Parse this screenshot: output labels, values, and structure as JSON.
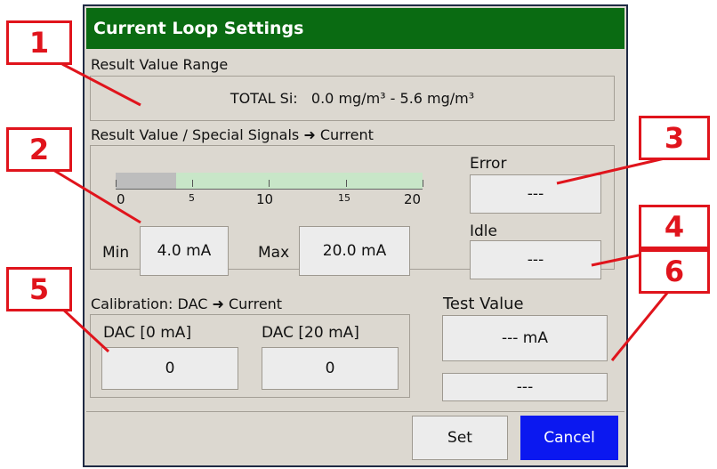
{
  "dialog": {
    "title": "Current Loop Settings"
  },
  "result_range": {
    "label": "Result Value Range",
    "value": "TOTAL Si:   0.0 mg/m³ - 5.6 mg/m³"
  },
  "signals": {
    "label": "Result Value / Special Signals ➜ Current",
    "gauge": {
      "scale_min": 0,
      "scale_max": 20,
      "filled_start_mA": 4,
      "tick_labels": [
        "0",
        "5",
        "10",
        "15",
        "20"
      ],
      "colors": {
        "below_min": "#bdbdbd",
        "range": "#c8e6c8"
      }
    },
    "min_label": "Min",
    "min_value": "4.0 mA",
    "max_label": "Max",
    "max_value": "20.0 mA",
    "error_label": "Error",
    "error_value": "---",
    "idle_label": "Idle",
    "idle_value": "---"
  },
  "calibration": {
    "label": "Calibration: DAC ➜ Current",
    "dac0_label": "DAC [0 mA]",
    "dac0_value": "0",
    "dac20_label": "DAC [20 mA]",
    "dac20_value": "0"
  },
  "test": {
    "label": "Test Value",
    "value": "--- mA",
    "status": "---"
  },
  "buttons": {
    "set": "Set",
    "cancel": "Cancel"
  },
  "callouts": [
    "1",
    "2",
    "3",
    "4",
    "5",
    "6"
  ],
  "colors": {
    "title_bar": "#0a6b12",
    "cancel_button": "#0b18f0",
    "callout": "#e0141c"
  }
}
